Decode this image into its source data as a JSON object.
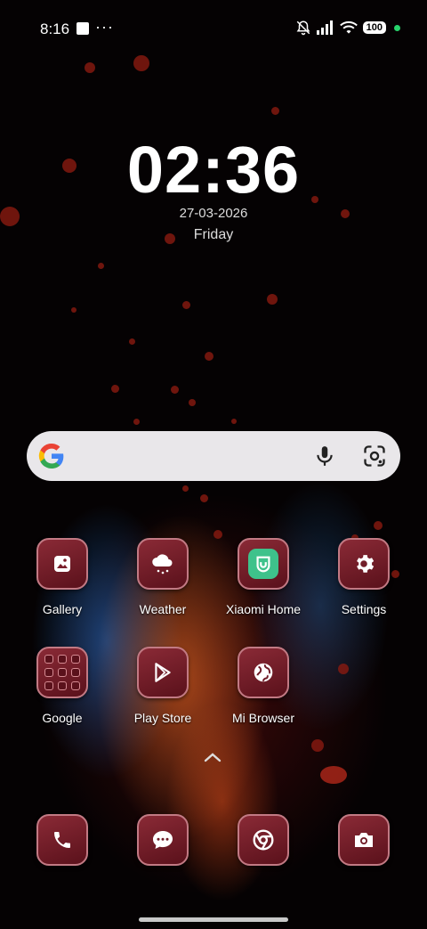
{
  "status_bar": {
    "time": "8:16",
    "overflow": "···",
    "battery": "100",
    "icons": [
      "notification-square-icon",
      "mute-bell-icon",
      "signal-icon",
      "wifi-icon",
      "battery-icon"
    ]
  },
  "clock": {
    "time": "02:36",
    "date": "27-03-2026",
    "day": "Friday"
  },
  "search": {
    "placeholder": "",
    "icons": [
      "google-logo-icon",
      "microphone-icon",
      "google-lens-icon"
    ]
  },
  "apps": [
    {
      "label": "Gallery",
      "icon": "gallery-icon"
    },
    {
      "label": "Weather",
      "icon": "weather-icon"
    },
    {
      "label": "Xiaomi Home",
      "icon": "xiaomi-home-icon"
    },
    {
      "label": "Settings",
      "icon": "gear-icon"
    },
    {
      "label": "Google",
      "icon": "folder-icon"
    },
    {
      "label": "Play Store",
      "icon": "play-store-icon"
    },
    {
      "label": "Mi Browser",
      "icon": "globe-icon"
    }
  ],
  "dock": [
    {
      "icon": "phone-icon"
    },
    {
      "icon": "messages-icon"
    },
    {
      "icon": "chrome-icon"
    },
    {
      "icon": "camera-icon"
    }
  ],
  "colors": {
    "icon_bg": "#6e1a26",
    "icon_border": "#c27a84",
    "search_bg": "#e9e7ea",
    "status_dot": "#27d36b"
  }
}
